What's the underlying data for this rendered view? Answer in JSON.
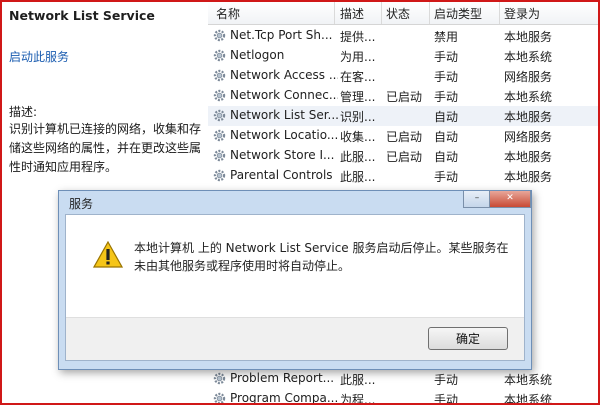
{
  "left_pane": {
    "service_title": "Network List Service",
    "start_link": "启动此服务",
    "description_label": "描述:",
    "description_text": "识别计算机已连接的网络，收集和存储这些网络的属性，并在更改这些属性时通知应用程序。"
  },
  "columns": {
    "name": "名称",
    "description": "描述",
    "status": "状态",
    "startup": "启动类型",
    "logon": "登录为"
  },
  "services": [
    {
      "name": "Net.Tcp Port Sh...",
      "desc": "提供...",
      "status": "",
      "startup": "禁用",
      "logon": "本地服务"
    },
    {
      "name": "Netlogon",
      "desc": "为用...",
      "status": "",
      "startup": "手动",
      "logon": "本地系统"
    },
    {
      "name": "Network Access ...",
      "desc": "在客...",
      "status": "",
      "startup": "手动",
      "logon": "网络服务"
    },
    {
      "name": "Network Connec...",
      "desc": "管理...",
      "status": "已启动",
      "startup": "手动",
      "logon": "本地系统"
    },
    {
      "name": "Network List Ser...",
      "desc": "识别...",
      "status": "",
      "startup": "自动",
      "logon": "本地服务"
    },
    {
      "name": "Network Locatio...",
      "desc": "收集...",
      "status": "已启动",
      "startup": "自动",
      "logon": "网络服务"
    },
    {
      "name": "Network Store I...",
      "desc": "此服...",
      "status": "已启动",
      "startup": "自动",
      "logon": "本地服务"
    },
    {
      "name": "Parental Controls",
      "desc": "此服...",
      "status": "",
      "startup": "手动",
      "logon": "本地服务"
    }
  ],
  "bottom_services": [
    {
      "name": "Problem Report...",
      "desc": "此服...",
      "status": "",
      "startup": "手动",
      "logon": "本地系统"
    },
    {
      "name": "Program Compa...",
      "desc": "为程...",
      "status": "",
      "startup": "手动",
      "logon": "本地系统"
    }
  ],
  "dialog": {
    "title": "服务",
    "message": "本地计算机 上的 Network List Service 服务启动后停止。某些服务在未由其他服务或程序使用时将自动停止。",
    "ok_label": "确定"
  },
  "colors": {
    "frame_border": "#d01818",
    "link": "#1a5cb0",
    "dialog_chrome": "#c9dcf1",
    "warning_fill": "#f5c518"
  },
  "icons": {
    "service": "gear-icon",
    "dialog": "warning-icon"
  }
}
